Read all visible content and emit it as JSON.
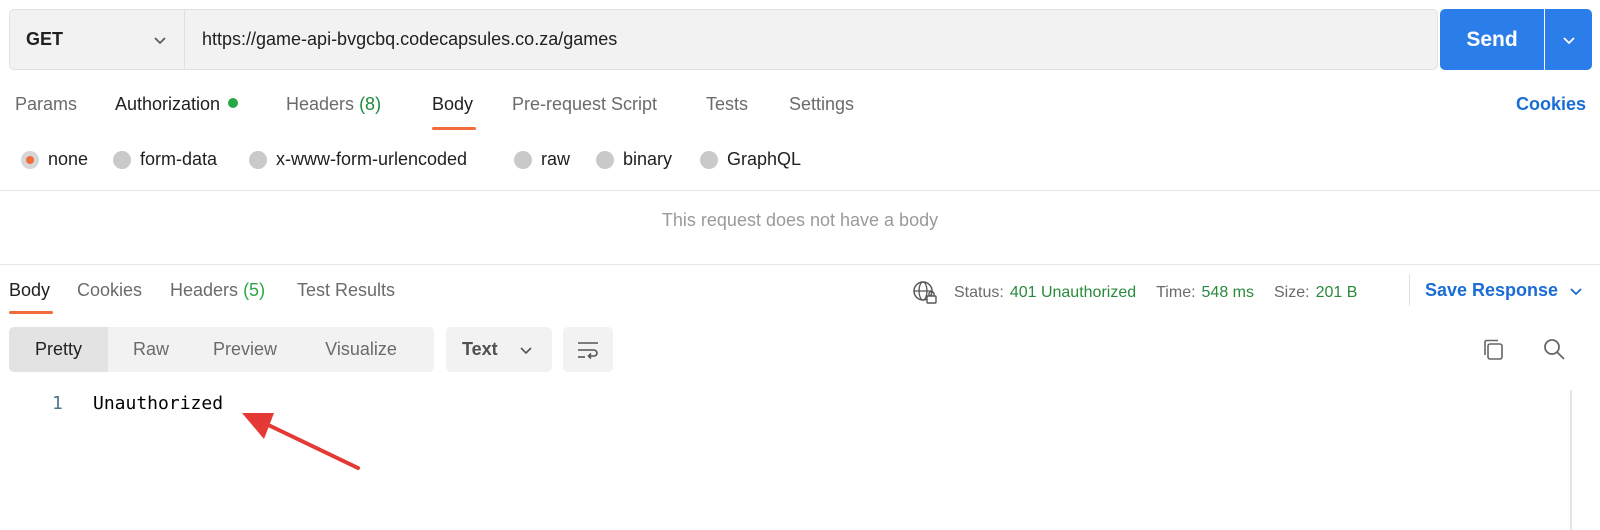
{
  "request": {
    "method": "GET",
    "url": "https://game-api-bvgcbq.codecapsules.co.za/games",
    "send_label": "Send"
  },
  "request_tabs": [
    {
      "label": "Params",
      "count": ""
    },
    {
      "label": "Authorization",
      "count": ""
    },
    {
      "label": "Headers",
      "count": "(8)"
    },
    {
      "label": "Body",
      "count": ""
    },
    {
      "label": "Pre-request Script",
      "count": ""
    },
    {
      "label": "Tests",
      "count": ""
    },
    {
      "label": "Settings",
      "count": ""
    }
  ],
  "cookies_label": "Cookies",
  "body_types": [
    "none",
    "form-data",
    "x-www-form-urlencoded",
    "raw",
    "binary",
    "GraphQL"
  ],
  "no_body_message": "This request does not have a body",
  "response_tabs": [
    {
      "label": "Body",
      "count": ""
    },
    {
      "label": "Cookies",
      "count": ""
    },
    {
      "label": "Headers",
      "count": "(5)"
    },
    {
      "label": "Test Results",
      "count": ""
    }
  ],
  "response_status": {
    "status_label": "Status:",
    "status_value": "401 Unauthorized",
    "time_label": "Time:",
    "time_value": "548 ms",
    "size_label": "Size:",
    "size_value": "201 B"
  },
  "save_response_label": "Save Response",
  "view_modes": [
    "Pretty",
    "Raw",
    "Preview",
    "Visualize"
  ],
  "format": "Text",
  "code_lines": [
    {
      "number": "1",
      "text": "Unauthorized"
    }
  ],
  "colors": {
    "accent": "#f26b3a",
    "primary": "#2b7de9",
    "link": "#1a6dd4",
    "success": "#2a8a3c"
  }
}
